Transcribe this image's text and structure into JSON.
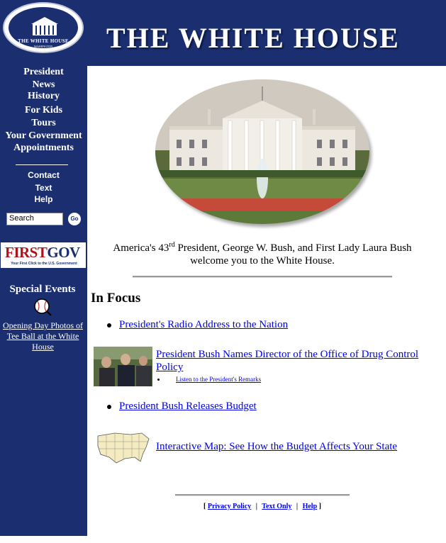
{
  "colors": {
    "navy": "#1b2f70",
    "red_bar": "#c8141e",
    "link": "#0000ee"
  },
  "banner": {
    "title": "THE WHITE HOUSE"
  },
  "seal": {
    "text": "THE WHITE HOUSE",
    "subtext": "WASHINGTON"
  },
  "nav": {
    "primary": [
      "President",
      "News",
      "History",
      "For Kids",
      "Tours",
      "Your Government",
      "Appointments"
    ],
    "secondary": [
      "Contact",
      "Text",
      "Help"
    ]
  },
  "search": {
    "value": "Search",
    "button_label": "Go",
    "icon": "go-icon"
  },
  "firstgov": {
    "logo_first": "FIRST",
    "logo_gov": "GOV",
    "tagline": "Your First Click to the U.S. Government"
  },
  "special_events": {
    "heading": "Special Events",
    "icon": "baseball-icon",
    "link": "Opening Day Photos of Tee Ball at the White House"
  },
  "welcome": {
    "line1_before": "America's 43",
    "line1_sup": "rd",
    "line1_after": " President, George W. Bush, and First Lady Laura Bush",
    "line2": "welcome you to the White House."
  },
  "in_focus": {
    "heading": "In Focus",
    "items": [
      {
        "label": "President's Radio Address to the Nation"
      },
      {
        "label_line1": "President Bush Names Director of the Office of Drug Control",
        "label_line2": "Policy",
        "sublink": "Listen to the President's Remarks"
      },
      {
        "label": "President Bush Releases Budget"
      },
      {
        "label": "Interactive Map: See How the Budget Affects Your State"
      }
    ]
  },
  "footer": {
    "links": [
      "Privacy Policy",
      "Text Only",
      "Help"
    ],
    "open": "[",
    "close": "]",
    "sep": "|"
  }
}
